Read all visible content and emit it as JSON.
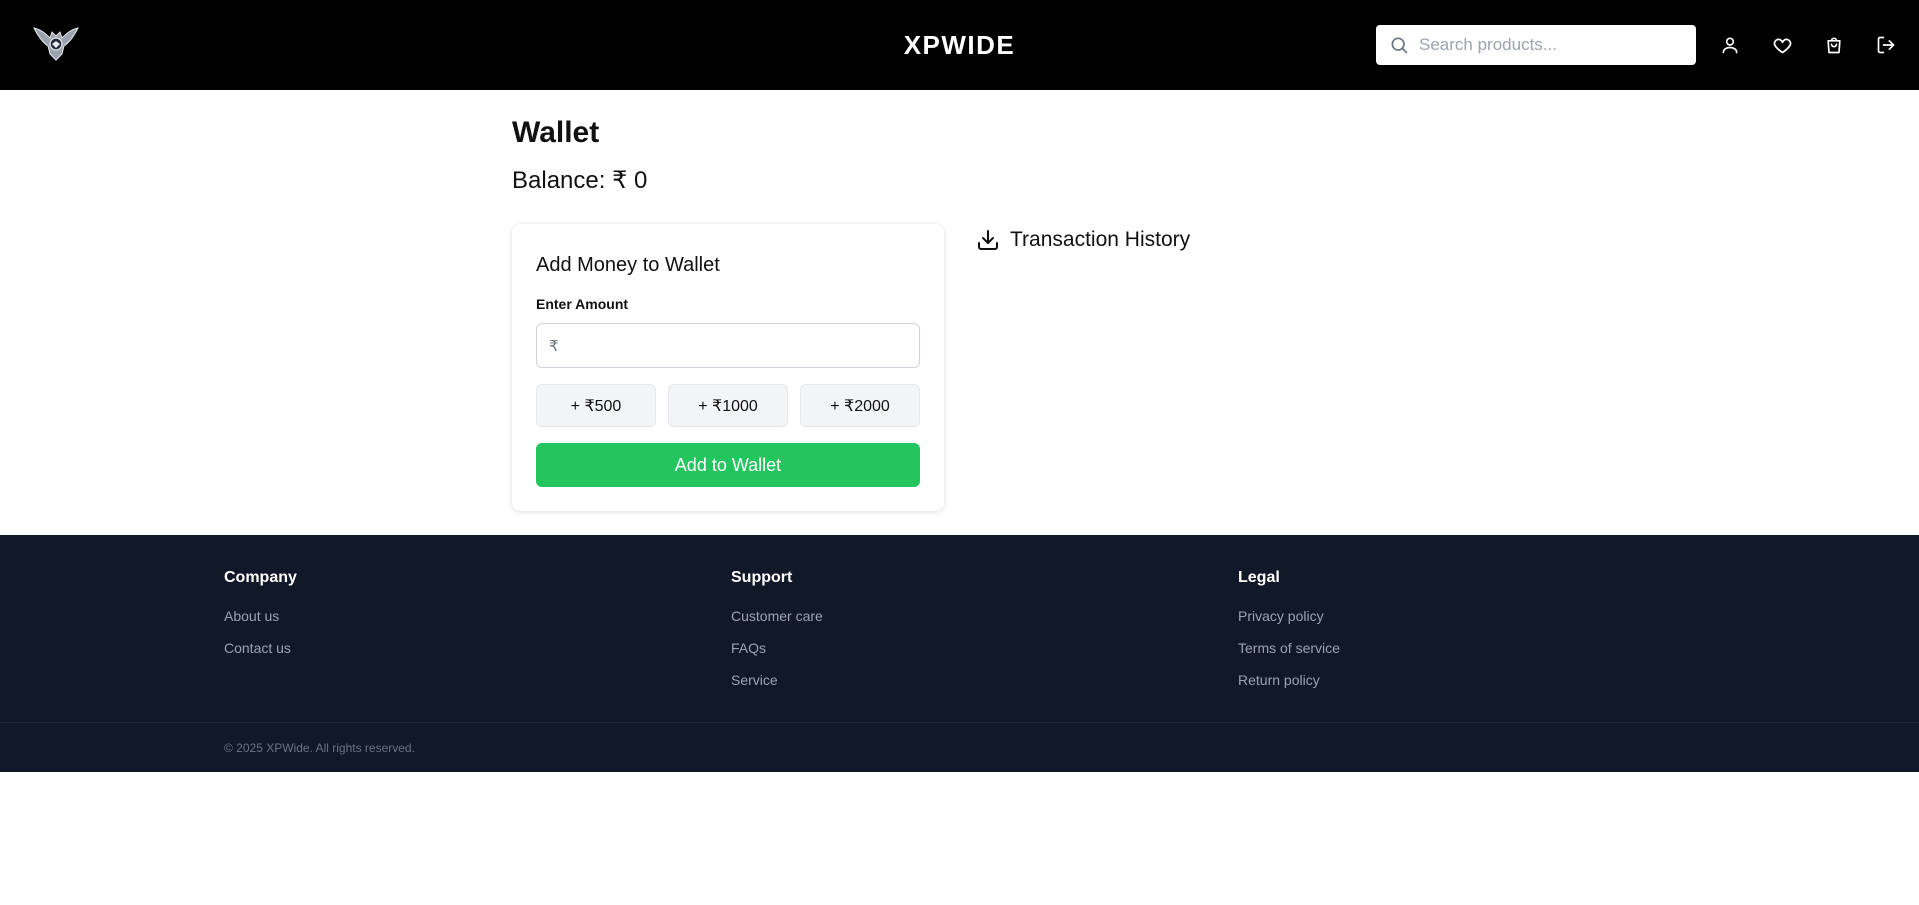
{
  "header": {
    "brand": "XPWIDE",
    "search_placeholder": "Search products...",
    "icons": [
      "user-icon",
      "heart-icon",
      "shopping-bag-icon",
      "logout-icon"
    ]
  },
  "wallet": {
    "title": "Wallet",
    "balance_label": "Balance:",
    "balance_value": "₹ 0",
    "card_title": "Add Money to Wallet",
    "amount_label": "Enter Amount",
    "currency_symbol": "₹",
    "amount_value": "",
    "quick_add": [
      "+ ₹500",
      "+ ₹1000",
      "+ ₹2000"
    ],
    "add_button": "Add to Wallet",
    "transaction_history": "Transaction History"
  },
  "footer": {
    "columns": [
      {
        "heading": "Company",
        "links": [
          "About us",
          "Contact us"
        ]
      },
      {
        "heading": "Support",
        "links": [
          "Customer care",
          "FAQs",
          "Service"
        ]
      },
      {
        "heading": "Legal",
        "links": [
          "Privacy policy",
          "Terms of service",
          "Return policy"
        ]
      }
    ],
    "copyright": "© 2025 XPWide. All rights reserved."
  },
  "colors": {
    "header_bg": "#000000",
    "accent_green": "#22c55e",
    "footer_bg": "#111827"
  }
}
